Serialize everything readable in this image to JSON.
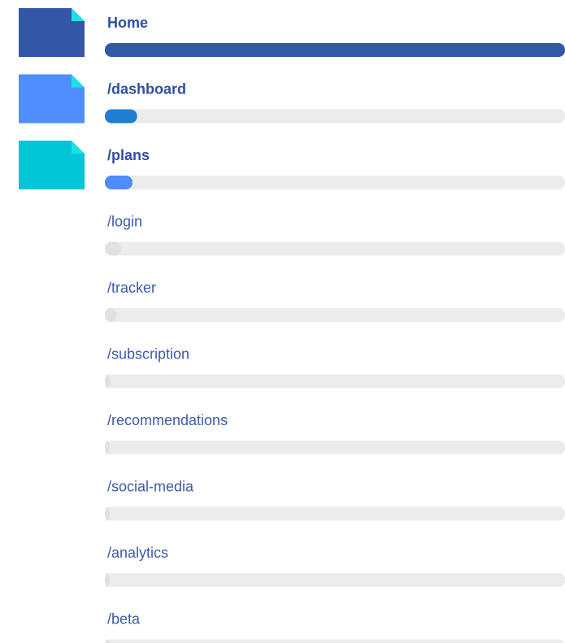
{
  "chart_data": {
    "type": "bar",
    "orientation": "horizontal",
    "categories": [
      "Home",
      "/dashboard",
      "/plans",
      "/login",
      "/tracker",
      "/subscription",
      "/recommendations",
      "/social-media",
      "/analytics",
      "/beta"
    ],
    "values": [
      100,
      7,
      6,
      3.5,
      2.5,
      1.2,
      1.0,
      0.9,
      0.7,
      0.5
    ],
    "xlim": [
      0,
      100
    ],
    "highlight_top_n": 3,
    "colors": {
      "bar_top_1": "#3358a8",
      "bar_top_2": "#1f7ed0",
      "bar_top_3": "#4f8cff",
      "bar_other": "#e1e1e1",
      "track": "#ececec",
      "icon_1": "#3357a6",
      "icon_2": "#4e8eff",
      "icon_3": "#00c6d6",
      "icon_fold": "#1de0e6",
      "label_top": "#2f4fa1",
      "label_other": "#3d5aa8"
    },
    "icons": [
      "document-icon",
      "document-icon",
      "document-icon"
    ]
  }
}
